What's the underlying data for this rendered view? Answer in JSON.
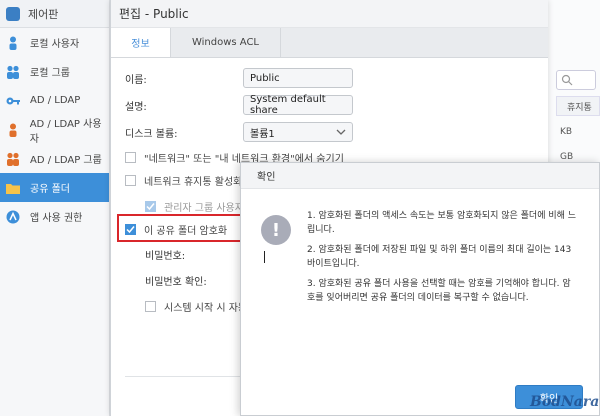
{
  "sidebar": {
    "title": "제어판",
    "items": [
      {
        "label": "로컬 사용자",
        "icon": "user-icon",
        "color": "#3d8fd9"
      },
      {
        "label": "로컬 그룹",
        "icon": "group-icon",
        "color": "#3d8fd9"
      },
      {
        "label": "AD / LDAP",
        "icon": "key-icon",
        "color": "#3d8fd9"
      },
      {
        "label": "AD / LDAP 사용자",
        "icon": "user-icon",
        "color": "#e0702c"
      },
      {
        "label": "AD / LDAP 그룹",
        "icon": "group-icon",
        "color": "#e0702c"
      },
      {
        "label": "공유 폴더",
        "icon": "folder-icon",
        "color": "#f2b233",
        "active": true
      },
      {
        "label": "앱 사용 권한",
        "icon": "app-permission-icon",
        "color": "#3d8fd9"
      }
    ]
  },
  "background": {
    "column_header": "휴지통",
    "cells": [
      "KB",
      "GB"
    ]
  },
  "edit": {
    "title": "편집 - Public",
    "tabs": [
      "정보",
      "Windows ACL"
    ],
    "name_label": "이름:",
    "name_value": "Public",
    "desc_label": "설명:",
    "desc_value": "System default share",
    "volume_label": "디스크 볼륨:",
    "volume_value": "볼륨1",
    "hide_label": "\"네트워크\" 또는 \"내 네트워크 환경\"에서 숨기기",
    "recycle_label": "네트워크 휴지통 활성화",
    "admin_only_label": "관리자 그룹 사용자",
    "encrypt_label": "이 공유 폴더 암호화",
    "password_label": "비밀번호:",
    "password_confirm_label": "비밀번호 확인:",
    "mount_label": "시스템 시작 시 자동"
  },
  "dialog": {
    "title": "확인",
    "msg1": "1. 암호화된 폴더의 액세스 속도는 보통 암호화되지 않은 폴더에 비해 느립니다.",
    "msg2": "2. 암호화된 폴더에 저장된 파일 및 하위 폴더 이름의 최대 길이는 143 바이트입니다.",
    "msg3": "3. 암호화된 공유 폴더 사용을 선택할 때는 암호를 기억해야 합니다. 암호를 잊어버리면 공유 폴더의 데이터를 복구할 수 없습니다.",
    "ok_label": "확인"
  },
  "watermark": "BodNara"
}
